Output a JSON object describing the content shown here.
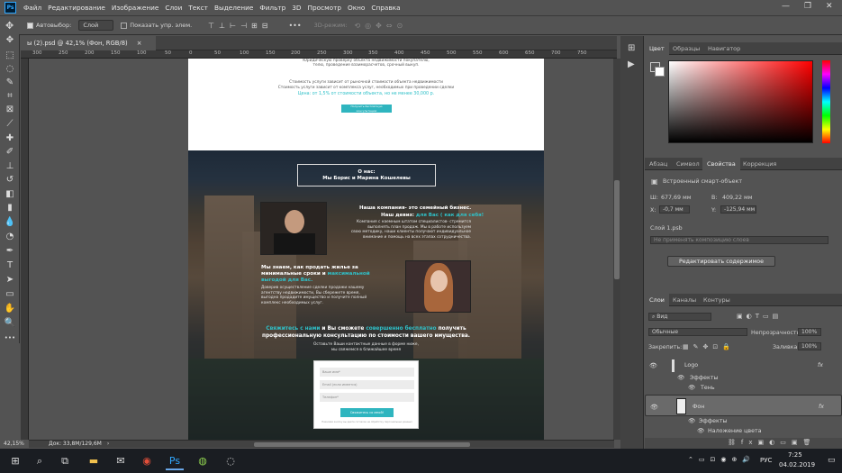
{
  "menubar": {
    "logo": "Ps",
    "items": [
      "Файл",
      "Редактирование",
      "Изображение",
      "Слои",
      "Текст",
      "Выделение",
      "Фильтр",
      "3D",
      "Просмотр",
      "Окно",
      "Справка"
    ],
    "win_min": "—",
    "win_max": "❐",
    "win_close": "✕"
  },
  "options": {
    "autoselect_label": "Автовыбор:",
    "autoselect_value": "Слой",
    "show_controls_label": "Показать упр. элем.",
    "mode_3d": "3D-режим:"
  },
  "tab": {
    "title": "ы (2).psd @ 42,1% (Фон, RGB/8)",
    "close": "×"
  },
  "ruler_ticks": [
    "300",
    "250",
    "200",
    "150",
    "100",
    "50",
    "0",
    "50",
    "100",
    "150",
    "200",
    "250",
    "300",
    "350",
    "400",
    "450",
    "500",
    "550",
    "600",
    "650",
    "700",
    "750"
  ],
  "canvas": {
    "top_texts": [
      "Юридическую проверку объекта недвижимости покупателю,",
      "телю, проведение взаиморасчетов, срочный выкуп.",
      "Стоимость услуги зависит от рыночной стоимости объекта недвижимости",
      "Стоимость услуги зависит от комплекса услуг, необходимых при проведении сделки"
    ],
    "price": "Цена: от 1,5% от стоимости объекта, но не менее 30,000 р.",
    "consult_button": "Получить бесплатную консультацию",
    "about_line1": "О нас:",
    "about_line2": "Мы Борис и Марина Кошелевы",
    "family_title": "Наша компания- это семейный бизнес.",
    "motto_prefix": "Наш девиз: ",
    "motto_highlight": "для Вас ( как для себя!",
    "family_desc": [
      "Компания с наемным штатом специалистов- стремится",
      "выполнять план продаж. Мы в работе используем",
      "свою методику, наши клиенты получают индивидуальное",
      "внимание и помощь на всех этапах сотрудничества."
    ],
    "sell_title1": "Мы знаем, как продать жилье за",
    "sell_title2_prefix": "минимальные сроки и ",
    "sell_title2_highlight": "максимальной",
    "sell_title3_highlight": "выгодой для Вас.",
    "sell_desc": [
      "Доверив осуществление сделки продажи нашему",
      "агентству недвижимости, Вы сбережете время,",
      "выгодно продадите имущество и получите полный",
      "комплекс необходимых услуг."
    ],
    "cta_hl1": "Свяжитесь с нами",
    "cta_mid": " и Вы сможете ",
    "cta_hl2": "совершенно бесплатно",
    "cta_end": " получить",
    "cta_line2": "профессиональную консультацию по стоимости вашего имущества.",
    "cta_sub1": "Оставьте Ваши контактные данные в форме ниже,",
    "cta_sub2": "мы свяжемся в ближайшее время",
    "form": {
      "name_placeholder": "Ваше имя*",
      "email_placeholder": "Email (если имеется)",
      "phone_placeholder": "Телефон*",
      "submit": "Свяжитесь со мной!",
      "note": "Нажимая кнопку вы даете согласие на обработку персональных данных"
    }
  },
  "status": {
    "zoom": "42,15%",
    "doc": "Док: 33,8M/129,6M",
    "arrow": "›"
  },
  "panels": {
    "color_tabs": [
      "Цвет",
      "Образцы",
      "Навигатор"
    ],
    "props_tabs": [
      "Абзац",
      "Символ",
      "Свойства",
      "Коррекция"
    ],
    "smart_object": "Встроенный смарт-объект",
    "w_label": "Ш:",
    "w_value": "677,69 мм",
    "h_label": "В:",
    "h_value": "409,22 мм",
    "x_label": "X:",
    "x_value": "-0,7 мм",
    "y_label": "Y:",
    "y_value": "-125,94 мм",
    "source": "Слой 1.psb",
    "comp_placeholder": "Не применять композицию слоев",
    "edit_button": "Редактировать содержимое",
    "layers_tabs": [
      "Слои",
      "Каналы",
      "Контуры"
    ],
    "filter_label": "Вид",
    "blend_mode": "Обычные",
    "opacity_label": "Непрозрачность:",
    "opacity_value": "100%",
    "lock_label": "Закрепить:",
    "fill_label": "Заливка:",
    "fill_value": "100%",
    "layers": [
      {
        "name": "Logo",
        "fx": "fx"
      },
      {
        "name": "Эффекты"
      },
      {
        "name": "Тень"
      },
      {
        "name": "Фон",
        "fx": "fx"
      },
      {
        "name": "Эффекты"
      },
      {
        "name": "Наложение цвета"
      }
    ]
  },
  "taskbar": {
    "lang": "РУС",
    "time": "7:25",
    "date": "04.02.2019"
  },
  "colors": {
    "accent": "#2fc0c8",
    "ps_blue": "#31a8ff"
  }
}
